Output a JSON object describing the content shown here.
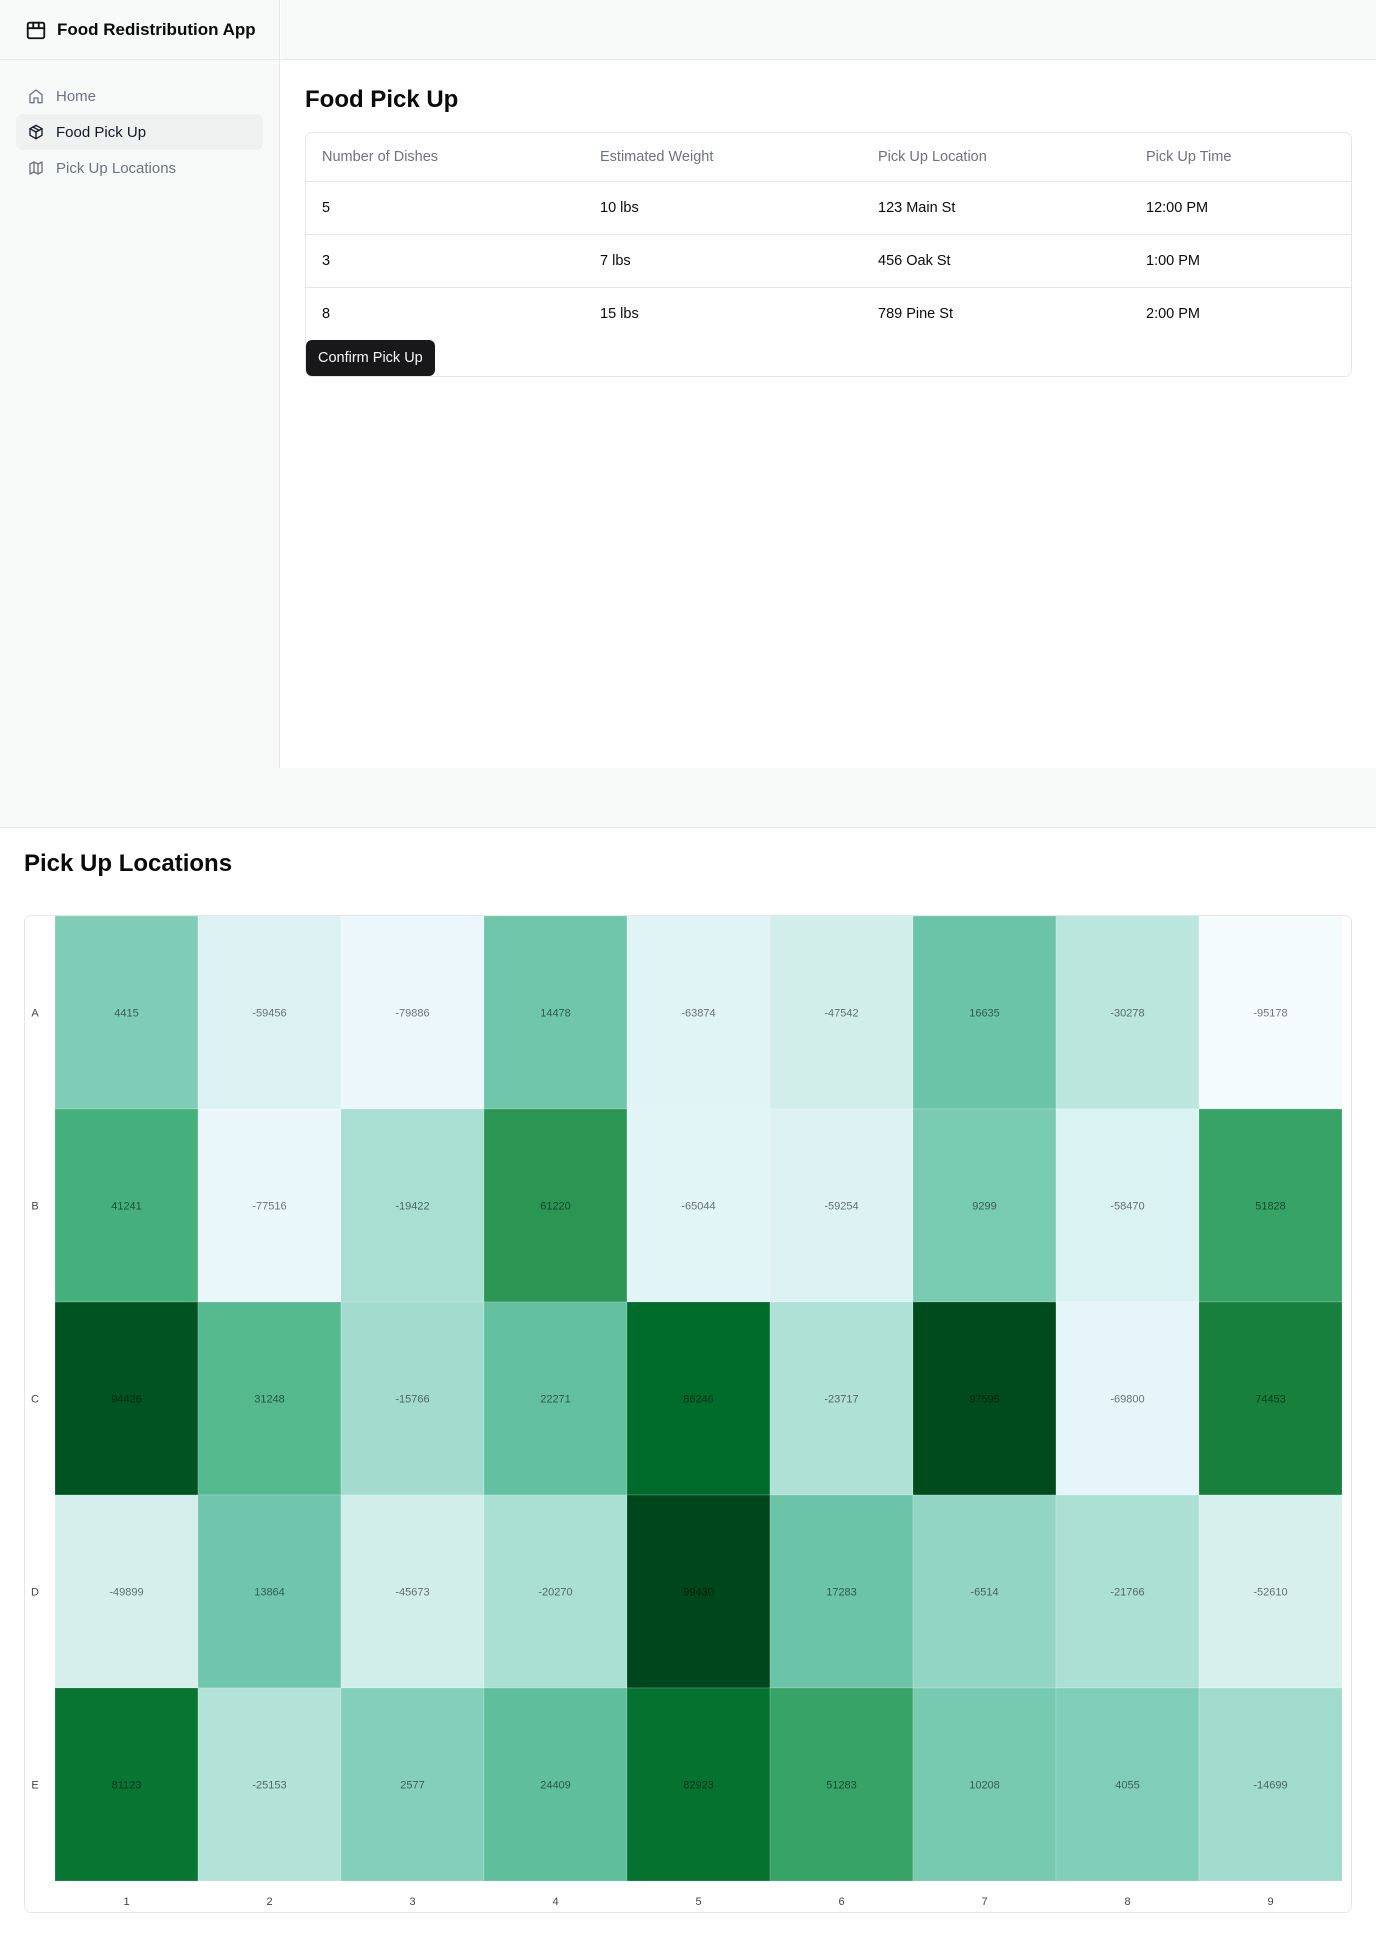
{
  "app": {
    "title": "Food Redistribution App"
  },
  "sidebar": {
    "items": [
      {
        "label": "Home",
        "icon": "home-icon"
      },
      {
        "label": "Food Pick Up",
        "icon": "package-icon",
        "active": true
      },
      {
        "label": "Pick Up Locations",
        "icon": "map-icon"
      }
    ]
  },
  "food_pick_up": {
    "title": "Food Pick Up",
    "columns": [
      "Number of Dishes",
      "Estimated Weight",
      "Pick Up Location",
      "Pick Up Time"
    ],
    "rows": [
      [
        "5",
        "10 lbs",
        "123 Main St",
        "12:00 PM"
      ],
      [
        "3",
        "7 lbs",
        "456 Oak St",
        "1:00 PM"
      ],
      [
        "8",
        "15 lbs",
        "789 Pine St",
        "2:00 PM"
      ]
    ],
    "confirm_label": "Confirm Pick Up"
  },
  "pick_up_locations": {
    "title": "Pick Up Locations"
  },
  "colors": {
    "primary_button": "#18181b",
    "heat_low": "#f7fcfd",
    "heat_high": "#00441b"
  },
  "chart_data": {
    "type": "heatmap",
    "title": "",
    "xlabel": "",
    "ylabel": "",
    "x": [
      "1",
      "2",
      "3",
      "4",
      "5",
      "6",
      "7",
      "8",
      "9"
    ],
    "y": [
      "A",
      "B",
      "C",
      "D",
      "E"
    ],
    "values": [
      [
        4415,
        -59456,
        -79886,
        14478,
        -63874,
        -47542,
        16635,
        -30278,
        -95178
      ],
      [
        41241,
        -77516,
        -19422,
        61220,
        -65044,
        -59254,
        9299,
        -58470,
        51828
      ],
      [
        94426,
        31248,
        -15766,
        22271,
        86246,
        -23717,
        97595,
        -69800,
        74453
      ],
      [
        -49899,
        13864,
        -45673,
        -20270,
        99430,
        17283,
        -6514,
        -21766,
        -52610
      ],
      [
        81123,
        -25153,
        2577,
        24409,
        82923,
        51283,
        10208,
        4055,
        -14699
      ]
    ],
    "color_scale": "BuGn",
    "value_range": [
      -100000,
      100000
    ],
    "legend": "none",
    "grid": false
  }
}
